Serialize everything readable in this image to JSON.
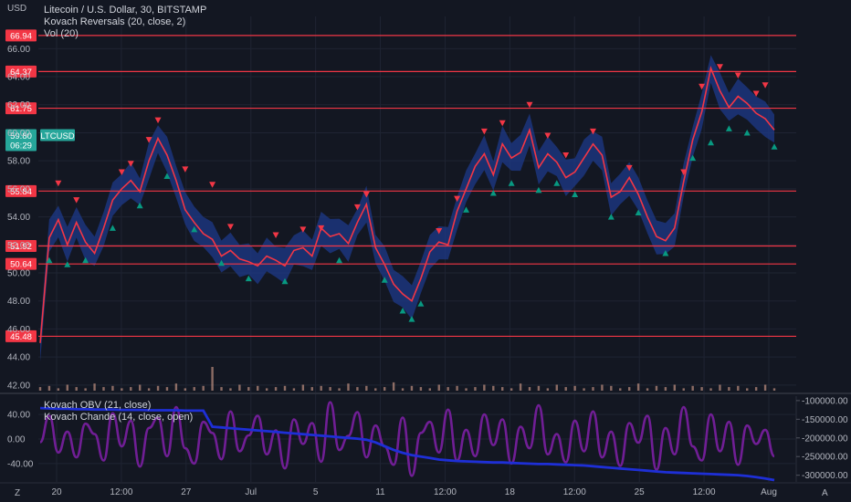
{
  "chart_data": {
    "type": "line",
    "symbol": "LTCUSD",
    "title": "Litecoin / U.S. Dollar, 30, BITSTAMP",
    "indicators": [
      "Kovach Reversals (20, close, 2)",
      "Vol (20)"
    ],
    "y_axis_unit": "USD",
    "y_ticks": [
      42.0,
      44.0,
      46.0,
      48.0,
      50.0,
      52.0,
      54.0,
      56.0,
      58.0,
      60.0,
      62.0,
      64.0,
      66.0
    ],
    "ylim": [
      41.6,
      68.3
    ],
    "x_ticks": [
      "20",
      "12:00",
      "27",
      "Jul",
      "5",
      "11",
      "12:00",
      "18",
      "12:00",
      "25",
      "12:00",
      "Aug"
    ],
    "price_series": {
      "name": "LTCUSD",
      "x": [
        0,
        1,
        2,
        3,
        4,
        5,
        6,
        7,
        8,
        9,
        10,
        11,
        12,
        13,
        14,
        15,
        16,
        17,
        18,
        19,
        20,
        21,
        22,
        23,
        24,
        25,
        26,
        27,
        28,
        29,
        30,
        31,
        32,
        33,
        34,
        35,
        36,
        37,
        38,
        39,
        40,
        41,
        42,
        43,
        44,
        45,
        46,
        47,
        48,
        49,
        50,
        51,
        52,
        53,
        54,
        55,
        56,
        57,
        58,
        59,
        60,
        61,
        62,
        63,
        64,
        65,
        66,
        67,
        68,
        69,
        70,
        71,
        72,
        73,
        74,
        75,
        76,
        77,
        78,
        79,
        80,
        81
      ],
      "values": [
        45.0,
        52.5,
        53.8,
        52.0,
        53.6,
        52.2,
        51.4,
        53.2,
        55.2,
        56.0,
        56.6,
        55.8,
        58.0,
        59.6,
        58.4,
        56.6,
        54.5,
        53.6,
        52.8,
        52.4,
        51.2,
        51.6,
        51.0,
        50.8,
        50.5,
        51.2,
        50.9,
        50.5,
        51.6,
        51.8,
        51.2,
        53.2,
        52.6,
        52.8,
        52.1,
        53.6,
        54.9,
        51.8,
        50.6,
        49.2,
        48.5,
        48.0,
        49.6,
        51.5,
        52.2,
        52.0,
        54.4,
        56.0,
        57.6,
        58.5,
        57.0,
        59.2,
        58.2,
        58.6,
        60.2,
        57.5,
        58.5,
        57.9,
        56.8,
        57.2,
        58.2,
        59.2,
        58.4,
        55.4,
        55.8,
        56.8,
        55.6,
        54.0,
        52.6,
        52.3,
        53.2,
        56.5,
        59.5,
        61.5,
        64.6,
        63.0,
        61.8,
        62.6,
        62.1,
        61.4,
        61.0,
        60.2
      ]
    },
    "band_width": 1.1,
    "horizontal_levels": [
      {
        "value": 66.94,
        "label": "66.94"
      },
      {
        "value": 64.37,
        "label": "64.37"
      },
      {
        "value": 61.75,
        "label": "61.75"
      },
      {
        "value": 55.84,
        "label": "55.84"
      },
      {
        "value": 51.92,
        "label": "51.92"
      },
      {
        "value": 50.64,
        "label": "50.64"
      },
      {
        "value": 45.48,
        "label": "45.48"
      }
    ],
    "last_price": {
      "value": 59.8,
      "label": "59.80",
      "symbol": "LTCUSD",
      "countdown": "06:29"
    },
    "bearish_reversal_markers": [
      {
        "x": 2,
        "y": 56.4
      },
      {
        "x": 4,
        "y": 55.2
      },
      {
        "x": 9,
        "y": 57.2
      },
      {
        "x": 10,
        "y": 57.8
      },
      {
        "x": 12,
        "y": 59.5
      },
      {
        "x": 13,
        "y": 60.9
      },
      {
        "x": 16,
        "y": 57.4
      },
      {
        "x": 19,
        "y": 56.3
      },
      {
        "x": 21,
        "y": 53.3
      },
      {
        "x": 26,
        "y": 52.7
      },
      {
        "x": 29,
        "y": 53.1
      },
      {
        "x": 31,
        "y": 53.2
      },
      {
        "x": 35,
        "y": 54.7
      },
      {
        "x": 36,
        "y": 55.6
      },
      {
        "x": 44,
        "y": 53.0
      },
      {
        "x": 46,
        "y": 55.3
      },
      {
        "x": 49,
        "y": 60.1
      },
      {
        "x": 51,
        "y": 60.7
      },
      {
        "x": 54,
        "y": 62.0
      },
      {
        "x": 56,
        "y": 59.8
      },
      {
        "x": 58,
        "y": 58.4
      },
      {
        "x": 61,
        "y": 60.1
      },
      {
        "x": 65,
        "y": 57.5
      },
      {
        "x": 71,
        "y": 57.2
      },
      {
        "x": 73,
        "y": 63.3
      },
      {
        "x": 75,
        "y": 64.7
      },
      {
        "x": 77,
        "y": 64.1
      },
      {
        "x": 79,
        "y": 62.8
      },
      {
        "x": 80,
        "y": 63.4
      }
    ],
    "bullish_reversal_markers": [
      {
        "x": 1,
        "y": 50.9
      },
      {
        "x": 3,
        "y": 50.6
      },
      {
        "x": 5,
        "y": 50.9
      },
      {
        "x": 8,
        "y": 53.2
      },
      {
        "x": 11,
        "y": 54.8
      },
      {
        "x": 14,
        "y": 56.9
      },
      {
        "x": 17,
        "y": 53.1
      },
      {
        "x": 20,
        "y": 50.7
      },
      {
        "x": 23,
        "y": 49.6
      },
      {
        "x": 27,
        "y": 49.4
      },
      {
        "x": 33,
        "y": 50.9
      },
      {
        "x": 38,
        "y": 49.5
      },
      {
        "x": 40,
        "y": 47.3
      },
      {
        "x": 41,
        "y": 46.7
      },
      {
        "x": 42,
        "y": 47.8
      },
      {
        "x": 47,
        "y": 54.5
      },
      {
        "x": 50,
        "y": 55.7
      },
      {
        "x": 52,
        "y": 56.4
      },
      {
        "x": 55,
        "y": 55.9
      },
      {
        "x": 57,
        "y": 56.4
      },
      {
        "x": 59,
        "y": 55.6
      },
      {
        "x": 63,
        "y": 54.0
      },
      {
        "x": 66,
        "y": 54.3
      },
      {
        "x": 69,
        "y": 51.4
      },
      {
        "x": 72,
        "y": 58.2
      },
      {
        "x": 74,
        "y": 59.3
      },
      {
        "x": 76,
        "y": 60.3
      },
      {
        "x": 78,
        "y": 60.0
      },
      {
        "x": 81,
        "y": 59.0
      }
    ],
    "volume_values": [
      3,
      4,
      2,
      5,
      3,
      2,
      6,
      3,
      4,
      2,
      3,
      5,
      2,
      4,
      3,
      6,
      2,
      3,
      4,
      20,
      3,
      2,
      5,
      3,
      4,
      2,
      3,
      4,
      2,
      5,
      3,
      4,
      3,
      2,
      6,
      3,
      4,
      2,
      3,
      7,
      2,
      4,
      3,
      2,
      5,
      3,
      4,
      2,
      3,
      5,
      4,
      3,
      2,
      6,
      3,
      4,
      2,
      5,
      3,
      4,
      2,
      3,
      5,
      4,
      2,
      3,
      6,
      2,
      4,
      3,
      5,
      2,
      4,
      3,
      2,
      5,
      3,
      4,
      2,
      3,
      5,
      2
    ],
    "sub_panel": {
      "legend": [
        "Kovach OBV (21, close)",
        "Kovach Chande (14, close, open)"
      ],
      "left_ticks": [
        40.0,
        0.0,
        -40.0
      ],
      "left_tick_labels": [
        "40.00",
        "0.00",
        "-40.00"
      ],
      "left_range": [
        -70,
        70
      ],
      "right_ticks": [
        -100000,
        -150000,
        -200000,
        -250000,
        -300000
      ],
      "right_tick_labels": [
        "-100000.00",
        "-150000.00",
        "-200000.00",
        "-250000.00",
        "-300000.00"
      ],
      "right_range": [
        -318000,
        -88000
      ],
      "chande": {
        "name": "Kovach Chande (14, close, open)",
        "values": [
          -5,
          38,
          -22,
          12,
          -30,
          25,
          8,
          -35,
          42,
          -12,
          30,
          -45,
          18,
          35,
          -28,
          52,
          -15,
          -40,
          28,
          10,
          -33,
          45,
          -20,
          6,
          38,
          -25,
          14,
          -48,
          32,
          -8,
          26,
          -37,
          60,
          -18,
          5,
          44,
          -30,
          22,
          -12,
          -42,
          35,
          -60,
          10,
          28,
          -22,
          48,
          -35,
          15,
          -28,
          40,
          -10,
          32,
          -40,
          20,
          -15,
          55,
          -25,
          8,
          -38,
          30,
          -20,
          45,
          -30,
          12,
          -44,
          26,
          -6,
          38,
          -50,
          18,
          -25,
          52,
          -12,
          -35,
          40,
          -20,
          28,
          -42,
          22,
          -8,
          15,
          -28
        ]
      },
      "obv": {
        "name": "Kovach OBV (21, close)",
        "values": [
          -120000,
          -121000,
          -122000,
          -122000,
          -123000,
          -123000,
          -124000,
          -124000,
          -124000,
          -125000,
          -125000,
          -125000,
          -126000,
          -126000,
          -126000,
          -126000,
          -127000,
          -127000,
          -127000,
          -170000,
          -172000,
          -174000,
          -176000,
          -178000,
          -180000,
          -182000,
          -184000,
          -186000,
          -188000,
          -190000,
          -192000,
          -194000,
          -196000,
          -198000,
          -200000,
          -202000,
          -205000,
          -212000,
          -222000,
          -232000,
          -240000,
          -246000,
          -250000,
          -254000,
          -258000,
          -260000,
          -262000,
          -263000,
          -264000,
          -265000,
          -266000,
          -266000,
          -267000,
          -268000,
          -269000,
          -270000,
          -270000,
          -271000,
          -272000,
          -273000,
          -274000,
          -276000,
          -278000,
          -280000,
          -282000,
          -284000,
          -286000,
          -288000,
          -290000,
          -292000,
          -293000,
          -294000,
          -295000,
          -296000,
          -297000,
          -298000,
          -299000,
          -300000,
          -302000,
          -305000,
          -309000,
          -313000
        ]
      }
    }
  },
  "colors": {
    "background": "#131722",
    "grid": "#1f2433",
    "level_line": "#f23645",
    "price_line": "#f23645",
    "band": "#1e3a8a",
    "bull_marker": "#089981",
    "bear_marker": "#f23645",
    "last_price": "#26a69a",
    "chande": "#7b1fa2",
    "obv": "#1e2fd6",
    "volume": "#f0b29a"
  },
  "bottom_icons": {
    "left": "Z",
    "right": "A"
  }
}
